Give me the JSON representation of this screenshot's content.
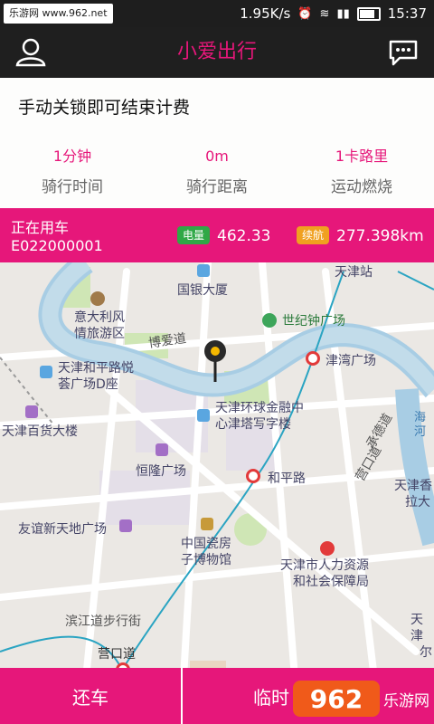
{
  "status_bar": {
    "watermark": "乐游网 www.962.net",
    "speed": "1.95K/s",
    "time": "15:37"
  },
  "app": {
    "title": "小爱出行",
    "icons": {
      "left": "user-icon",
      "right": "chat-icon"
    },
    "accent_color": "#e6177a"
  },
  "info_card": {
    "hint": "手动关锁即可结束计费",
    "stats": [
      {
        "value": "1分钟",
        "label": "骑行时间"
      },
      {
        "value": "0m",
        "label": "骑行距离"
      },
      {
        "value": "1卡路里",
        "label": "运动燃烧"
      }
    ]
  },
  "ride_bar": {
    "title": "正在用车",
    "bike_id": "E022000001",
    "power_label": "电量",
    "power_value": "462.33",
    "range_label": "续航",
    "range_value": "277.398km"
  },
  "map": {
    "labels": {
      "guoyin": "国银大厦",
      "italy_1": "意大利风",
      "italy_2": "情旅游区",
      "boai": "博爱道",
      "shiji": "世纪钟广场",
      "tianjinzhan": "天津站",
      "jinwan": "津湾广场",
      "heping_yue_1": "天津和平路悦",
      "heping_yue_2": "荟广场D座",
      "huanqiu_1": "天津环球金融中",
      "huanqiu_2": "心津塔写字楼",
      "baihuo": "天津百货大楼",
      "henglong": "恒隆广场",
      "hepinglu": "和平路",
      "chengde": "承德道",
      "yingkou_dao": "营口道",
      "haihe": "海河",
      "tianjin_xiang": "天津香",
      "lada": "拉大",
      "youyi": "友谊新天地广场",
      "cifang_1": "中国瓷房",
      "cifang_2": "子博物馆",
      "renli_1": "天津市人力资源",
      "renli_2": "和社会保障局",
      "binjiang": "滨江道步行街",
      "yingkou": "营口道",
      "tianjin_er_1": "天津",
      "tianjin_er_2": "尔"
    }
  },
  "actions": {
    "return": "还车",
    "temp": "临时",
    "logo_text": "962",
    "logo_sub": "乐游网"
  }
}
